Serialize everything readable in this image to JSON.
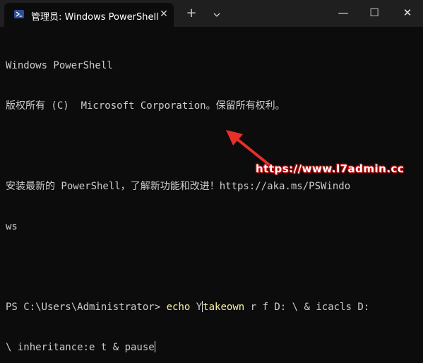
{
  "window": {
    "tab_title": "管理员: Windows PowerShell",
    "tab_close_glyph": "✕",
    "new_tab_glyph": "+",
    "minimize_glyph": "—",
    "maximize_glyph": "☐",
    "close_glyph": "✕"
  },
  "terminal": {
    "line1": "Windows PowerShell",
    "line2": "版权所有 (C)  Microsoft Corporation。保留所有权利。",
    "line3": "",
    "line4": "安装最新的 PowerShell，了解新功能和改进！https://aka.ms/PSWindo",
    "line5": "ws",
    "line6": "",
    "prompt_path": "PS C:\\Users\\Administrator",
    "prompt_arrow": ">",
    "cmd_keyword": "echo",
    "cmd_part1": " Y",
    "cmd_part2": "takeown",
    "cmd_part3": " r f D: \\ & icacls D:",
    "line8": "\\ inheritance:e t & pause"
  },
  "watermark": "https://www.l7admin.cc",
  "colors": {
    "background": "#0c0c0c",
    "titlebar": "#1f1f1f",
    "text": "#cccccc",
    "command_keyword": "#f9f1a5",
    "annotation": "#e8302a"
  }
}
